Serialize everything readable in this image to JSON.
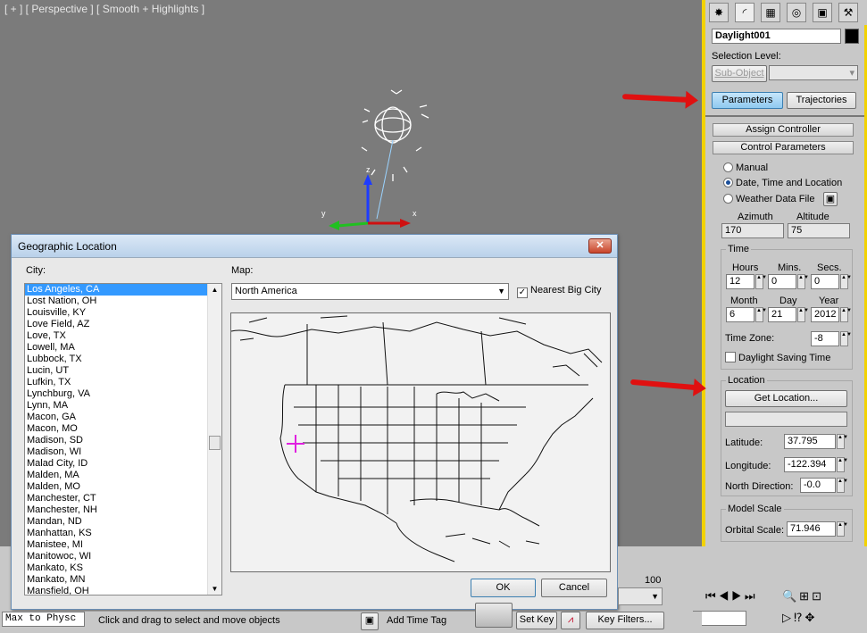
{
  "viewport": {
    "label": "[ + ] [ Perspective ] [ Smooth + Highlights ]",
    "axes": {
      "x": "x",
      "y": "y",
      "z": "z"
    }
  },
  "command_panel": {
    "tab_icons": [
      "create-icon",
      "modify-icon",
      "hierarchy-icon",
      "motion-icon",
      "display-icon",
      "utilities-icon"
    ],
    "object_name": "Daylight001",
    "selection_level_label": "Selection Level:",
    "sub_object_label": "Sub-Object",
    "parameters_label": "Parameters",
    "trajectories_label": "Trajectories",
    "assign_controller_label": "Assign Controller",
    "control_parameters_label": "Control Parameters",
    "mode_options": [
      "Manual",
      "Date, Time and Location",
      "Weather Data File"
    ],
    "selected_mode": "Date, Time and Location",
    "azimuth_label": "Azimuth",
    "altitude_label": "Altitude",
    "azimuth": "170",
    "altitude": "75",
    "time_group": "Time",
    "hours_label": "Hours",
    "mins_label": "Mins.",
    "secs_label": "Secs.",
    "hours": "12",
    "mins": "0",
    "secs": "0",
    "month_label": "Month",
    "day_label": "Day",
    "year_label": "Year",
    "month": "6",
    "day": "21",
    "year": "2012",
    "time_zone_label": "Time Zone:",
    "time_zone": "-8",
    "daylight_saving_label": "Daylight Saving Time",
    "location_group": "Location",
    "get_location_label": "Get Location...",
    "location_name": "",
    "latitude_label": "Latitude:",
    "latitude": "37.795",
    "longitude_label": "Longitude:",
    "longitude": "-122.394",
    "north_direction_label": "North Direction:",
    "north_direction": "-0.0",
    "model_scale_group": "Model Scale",
    "orbital_scale_label": "Orbital Scale:",
    "orbital_scale": "71.946",
    "accent": "#f2d200",
    "arrow_color": "#e01010"
  },
  "dialog": {
    "title": "Geographic Location",
    "city_label": "City:",
    "map_label": "Map:",
    "map_value": "North America",
    "nearest_big_city_label": "Nearest Big City",
    "nearest_big_city_checked": true,
    "selected_city": "Los Angeles, CA",
    "cities": [
      "Los Angeles, CA",
      "Lost Nation, OH",
      "Louisville, KY",
      "Love Field, AZ",
      "Love, TX",
      "Lowell, MA",
      "Lubbock, TX",
      "Lucin, UT",
      "Lufkin, TX",
      "Lynchburg, VA",
      "Lynn, MA",
      "Macon, GA",
      "Macon, MO",
      "Madison, SD",
      "Madison, WI",
      "Malad City, ID",
      "Malden, MA",
      "Malden, MO",
      "Manchester, CT",
      "Manchester, NH",
      "Mandan, ND",
      "Manhattan, KS",
      "Manistee, MI",
      "Manitowoc, WI",
      "Mankato, KS",
      "Mankato, MN",
      "Mansfield, OH"
    ],
    "ok_label": "OK",
    "cancel_label": "Cancel",
    "marker_color": "#e020e0"
  },
  "status": {
    "maxscript": "Max to Physc",
    "prompt": "Click and drag to select and move objects",
    "add_time_tag": "Add Time Tag",
    "set_key": "Set Key",
    "key_filters": "Key Filters...",
    "frame": "0",
    "timeline_end": "100"
  }
}
